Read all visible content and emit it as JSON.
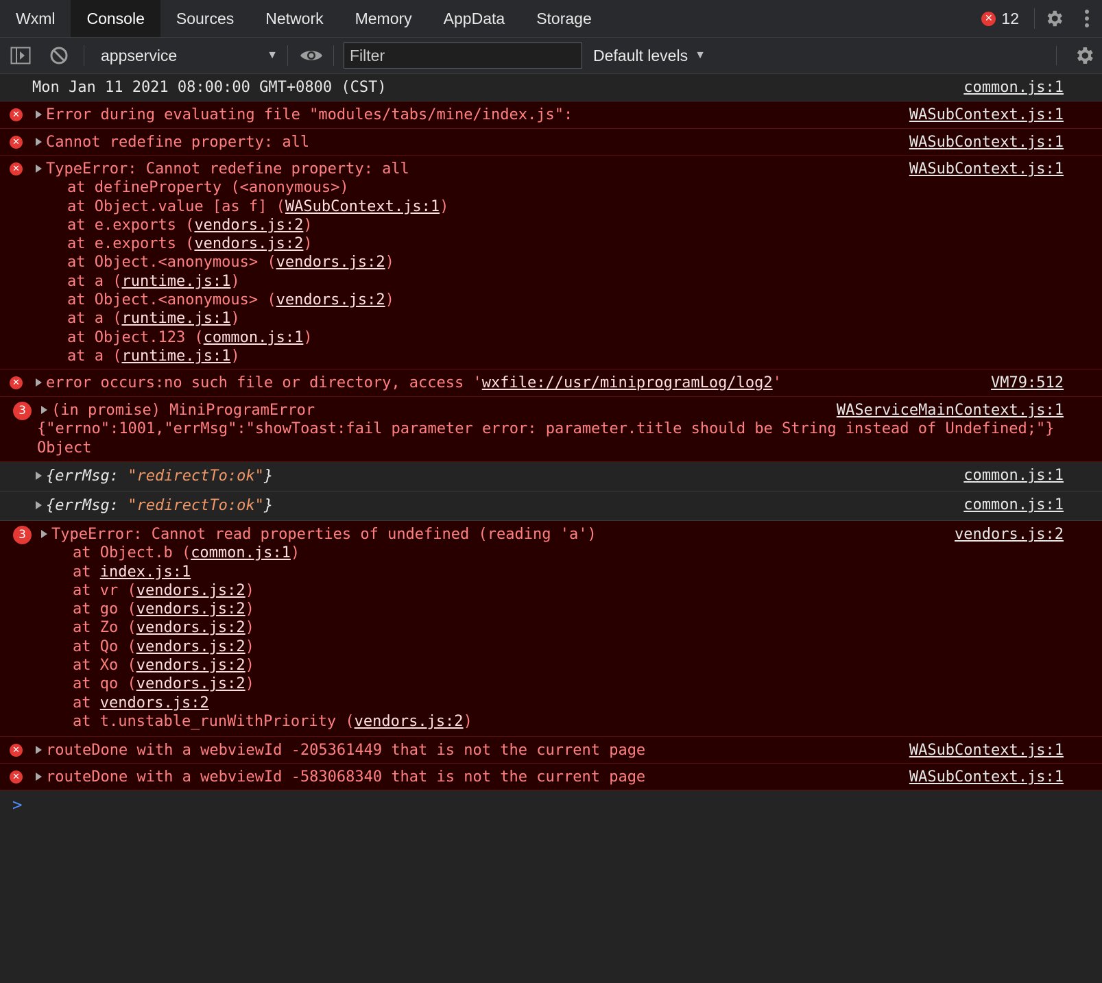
{
  "tabs": [
    {
      "label": "Wxml"
    },
    {
      "label": "Console"
    },
    {
      "label": "Sources"
    },
    {
      "label": "Network"
    },
    {
      "label": "Memory"
    },
    {
      "label": "AppData"
    },
    {
      "label": "Storage"
    }
  ],
  "error_count": "12",
  "toolbar": {
    "context": "appservice",
    "filter_placeholder": "Filter",
    "levels": "Default levels"
  },
  "console": {
    "timestamp": {
      "text": "Mon Jan 11 2021 08:00:00 GMT+0800 (CST)",
      "source": "common.js:1"
    },
    "m1": {
      "text": "Error during evaluating file \"modules/tabs/mine/index.js\":",
      "source": "WASubContext.js:1"
    },
    "m2": {
      "text": "Cannot redefine property: all",
      "source": "WASubContext.js:1"
    },
    "m3": {
      "text": "TypeError: Cannot redefine property: all",
      "source": "WASubContext.js:1",
      "stack": [
        {
          "pre": "at defineProperty (<anonymous>)",
          "link": "",
          "post": ""
        },
        {
          "pre": "at Object.value [as f] (",
          "link": "WASubContext.js:1",
          "post": ")"
        },
        {
          "pre": "at e.exports (",
          "link": "vendors.js:2",
          "post": ")"
        },
        {
          "pre": "at e.exports (",
          "link": "vendors.js:2",
          "post": ")"
        },
        {
          "pre": "at Object.<anonymous> (",
          "link": "vendors.js:2",
          "post": ")"
        },
        {
          "pre": "at a (",
          "link": "runtime.js:1",
          "post": ")"
        },
        {
          "pre": "at Object.<anonymous> (",
          "link": "vendors.js:2",
          "post": ")"
        },
        {
          "pre": "at a (",
          "link": "runtime.js:1",
          "post": ")"
        },
        {
          "pre": "at Object.123 (",
          "link": "common.js:1",
          "post": ")"
        },
        {
          "pre": "at a (",
          "link": "runtime.js:1",
          "post": ")"
        }
      ]
    },
    "m4": {
      "pre": "error occurs:no such file or directory, access '",
      "link": "wxfile://usr/miniprogramLog/log2",
      "post": "'",
      "source": "VM79:512"
    },
    "m5": {
      "count": "3",
      "text": "(in promise) MiniProgramError",
      "detail": "{\"errno\":1001,\"errMsg\":\"showToast:fail parameter error: parameter.title should be String instead of Undefined;\"}",
      "detail2": "Object",
      "source": "WAServiceMainContext.js:1"
    },
    "m6": {
      "key": "errMsg:",
      "value": "\"redirectTo:ok\"",
      "open": "{",
      "close": "}",
      "source": "common.js:1"
    },
    "m7": {
      "key": "errMsg:",
      "value": "\"redirectTo:ok\"",
      "open": "{",
      "close": "}",
      "source": "common.js:1"
    },
    "m8": {
      "count": "3",
      "text": "TypeError: Cannot read properties of undefined (reading 'a')",
      "source": "vendors.js:2",
      "stack": [
        {
          "pre": "at Object.b (",
          "link": "common.js:1",
          "post": ")"
        },
        {
          "pre": "at ",
          "link": "index.js:1",
          "post": ""
        },
        {
          "pre": "at vr (",
          "link": "vendors.js:2",
          "post": ")"
        },
        {
          "pre": "at go (",
          "link": "vendors.js:2",
          "post": ")"
        },
        {
          "pre": "at Zo (",
          "link": "vendors.js:2",
          "post": ")"
        },
        {
          "pre": "at Qo (",
          "link": "vendors.js:2",
          "post": ")"
        },
        {
          "pre": "at Xo (",
          "link": "vendors.js:2",
          "post": ")"
        },
        {
          "pre": "at qo (",
          "link": "vendors.js:2",
          "post": ")"
        },
        {
          "pre": "at ",
          "link": "vendors.js:2",
          "post": ""
        },
        {
          "pre": "at t.unstable_runWithPriority (",
          "link": "vendors.js:2",
          "post": ")"
        }
      ]
    },
    "m9": {
      "text": "routeDone with a webviewId -205361449 that is not the current page",
      "source": "WASubContext.js:1"
    },
    "m10": {
      "text": "routeDone with a webviewId -583068340 that is not the current page",
      "source": "WASubContext.js:1"
    },
    "prompt": ">"
  },
  "colors": {
    "error_bg": "#290000",
    "error_text": "#ff8080",
    "error_badge": "#e53935",
    "string_value": "#f29766",
    "prompt": "#4d8ef7"
  },
  "icons": {
    "error_badge_glyph": "✕",
    "dropdown": "▼"
  }
}
